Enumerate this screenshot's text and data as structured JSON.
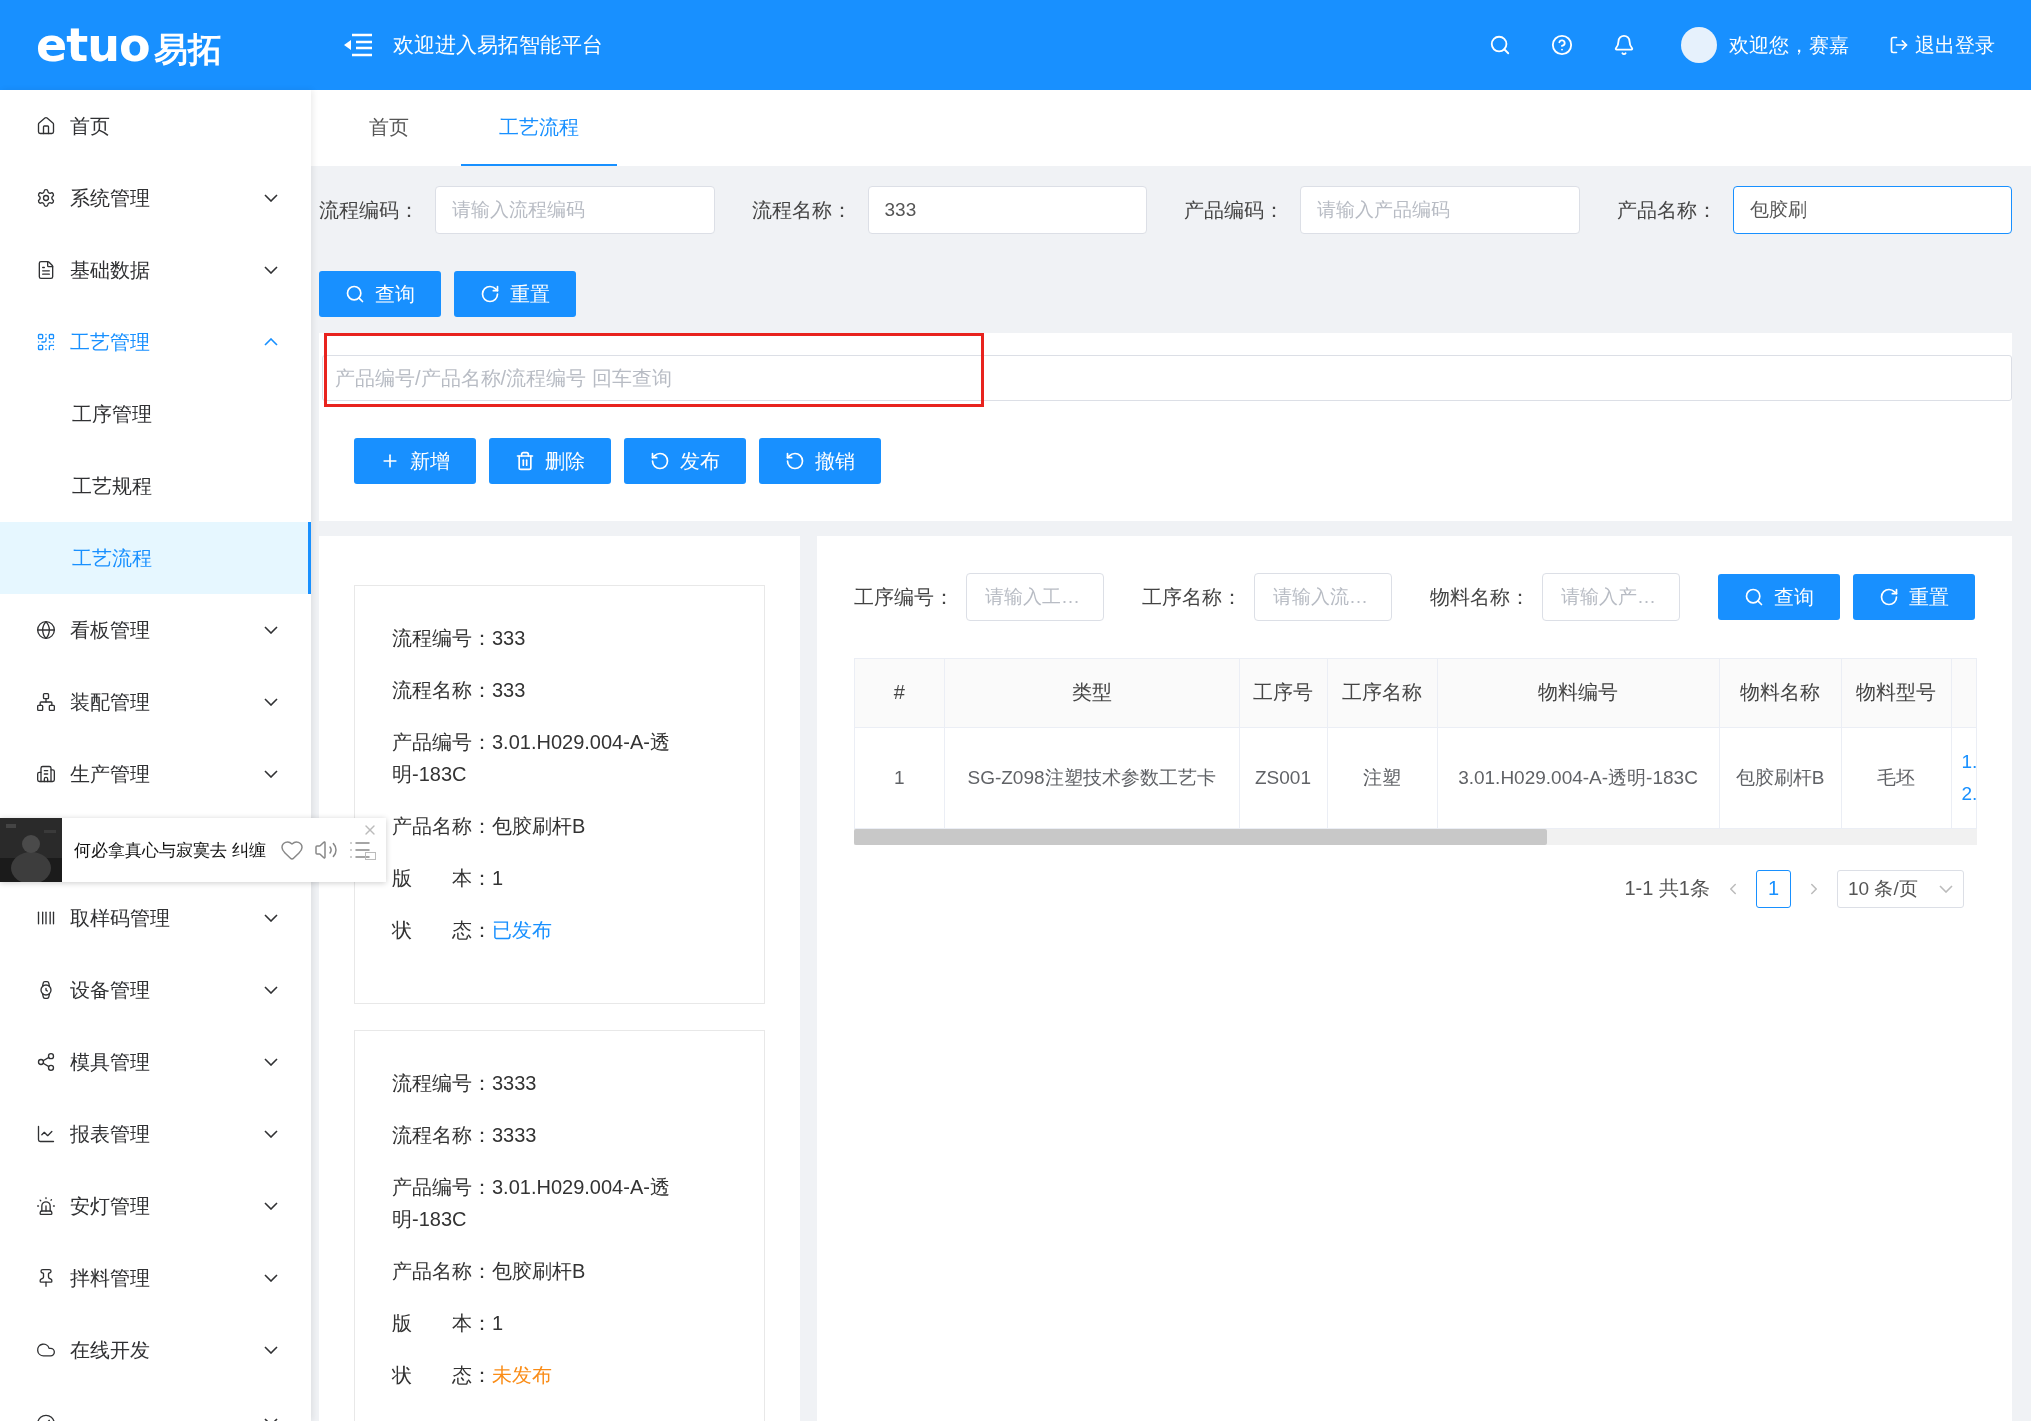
{
  "header": {
    "logo": {
      "latin": "etuo",
      "cjk": "易拓"
    },
    "title": "欢迎进入易拓智能平台",
    "greeting": "欢迎您，赛嘉",
    "logout": "退出登录"
  },
  "sidebar": {
    "menu": [
      {
        "kind": "link",
        "label": "首页"
      },
      {
        "kind": "group",
        "label": "系统管理",
        "expanded": false
      },
      {
        "kind": "group",
        "label": "基础数据",
        "expanded": false
      },
      {
        "kind": "group",
        "label": "工艺管理",
        "expanded": true,
        "children": [
          {
            "label": "工序管理",
            "selected": false
          },
          {
            "label": "工艺规程",
            "selected": false
          },
          {
            "label": "工艺流程",
            "selected": true
          }
        ]
      },
      {
        "kind": "group",
        "label": "看板管理",
        "expanded": false
      },
      {
        "kind": "group",
        "label": "装配管理",
        "expanded": false
      },
      {
        "kind": "group",
        "label": "生产管理",
        "expanded": false
      },
      {
        "kind": "player",
        "song": "何必拿真心与寂寞去 纠缠"
      },
      {
        "kind": "group",
        "label": "取样码管理",
        "expanded": false
      },
      {
        "kind": "group",
        "label": "设备管理",
        "expanded": false
      },
      {
        "kind": "group",
        "label": "模具管理",
        "expanded": false
      },
      {
        "kind": "group",
        "label": "报表管理",
        "expanded": false
      },
      {
        "kind": "group",
        "label": "安灯管理",
        "expanded": false
      },
      {
        "kind": "group",
        "label": "拌料管理",
        "expanded": false
      },
      {
        "kind": "group",
        "label": "在线开发",
        "expanded": false
      },
      {
        "kind": "group",
        "expanded": false
      }
    ]
  },
  "tabs": [
    {
      "label": "首页",
      "selected": false
    },
    {
      "label": "工艺流程",
      "selected": true
    }
  ],
  "filters": [
    {
      "label": "流程编码：",
      "placeholder": "请输入流程编码",
      "focused": false
    },
    {
      "label": "流程名称：",
      "value": "333",
      "focused": false
    },
    {
      "label": "产品编码：",
      "placeholder": "请输入产品编码",
      "focused": false
    },
    {
      "label": "产品名称：",
      "value": "包胶刷",
      "focused": true
    }
  ],
  "filter_buttons": [
    {
      "kind": "search",
      "label": "查询"
    },
    {
      "kind": "reset",
      "label": "重置"
    }
  ],
  "search": {
    "placeholder": "产品编号/产品名称/流程编号 回车查询",
    "highlighted": true
  },
  "actions": [
    {
      "kind": "add",
      "label": "新增"
    },
    {
      "kind": "delete",
      "label": "删除"
    },
    {
      "kind": "publish",
      "label": "发布"
    },
    {
      "kind": "revoke",
      "label": "撤销"
    }
  ],
  "flows": [
    {
      "fields": [
        {
          "label": "流程编号：",
          "value": "333"
        },
        {
          "label": "流程名称：",
          "value": "333"
        },
        {
          "label": "产品编号：",
          "value": "3.01.H029.004-A-透明-183C"
        },
        {
          "label": "产品名称：",
          "value": "包胶刷杆B"
        },
        {
          "label": "版本：",
          "value": "1"
        }
      ],
      "status": {
        "label": "状态：",
        "value": "已发布",
        "published": true
      }
    },
    {
      "fields": [
        {
          "label": "流程编号：",
          "value": "3333"
        },
        {
          "label": "流程名称：",
          "value": "3333"
        },
        {
          "label": "产品编号：",
          "value": "3.01.H029.004-A-透明-183C"
        },
        {
          "label": "产品名称：",
          "value": "包胶刷杆B"
        },
        {
          "label": "版本：",
          "value": "1"
        }
      ],
      "status": {
        "label": "状态：",
        "value": "未发布",
        "published": false
      }
    }
  ],
  "detail": {
    "filters": [
      {
        "label": "工序编号：",
        "placeholder": "请输入工…"
      },
      {
        "label": "工序名称：",
        "placeholder": "请输入流…"
      },
      {
        "label": "物料名称：",
        "placeholder": "请输入产…"
      }
    ],
    "buttons": [
      {
        "kind": "search",
        "label": "查询"
      },
      {
        "kind": "reset",
        "label": "重置"
      }
    ],
    "table": {
      "columns": [
        "#",
        "类型",
        "工序号",
        "工序名称",
        "物料编号",
        "物料名称",
        "物料型号"
      ],
      "rows": [
        {
          "cells": [
            "1",
            "SG-Z098注塑技术参数工艺卡",
            "ZS001",
            "注塑",
            "3.01.H029.004-A-透明-183C",
            "包胶刷杆B",
            "毛坯"
          ],
          "column_8": [
            "1.",
            "2."
          ]
        }
      ]
    },
    "pagination": {
      "summary": "1-1 共1条",
      "pages": [
        {
          "label": "1",
          "selected": true
        }
      ],
      "page_size": "10 条/页"
    }
  }
}
